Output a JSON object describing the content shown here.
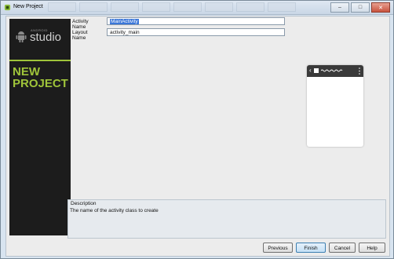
{
  "window": {
    "title": "New Project",
    "controls": {
      "minimize": "–",
      "maximize": "□",
      "close": "✕"
    }
  },
  "sidebar": {
    "logo_small": "ANDROID",
    "logo_text": "studio",
    "title_line1": "NEW",
    "title_line2": "PROJECT",
    "accent_color": "#9fc43a"
  },
  "form": {
    "activity_name": {
      "label": "Activity Name",
      "value": "MainActivity"
    },
    "layout_name": {
      "label": "Layout Name",
      "value": "activity_main"
    }
  },
  "preview": {
    "back_glyph": "‹"
  },
  "description": {
    "label": "Description",
    "text": "The name of the activity class to create"
  },
  "buttons": {
    "previous": "Previous",
    "finish": "Finish",
    "cancel": "Cancel",
    "help": "Help"
  }
}
